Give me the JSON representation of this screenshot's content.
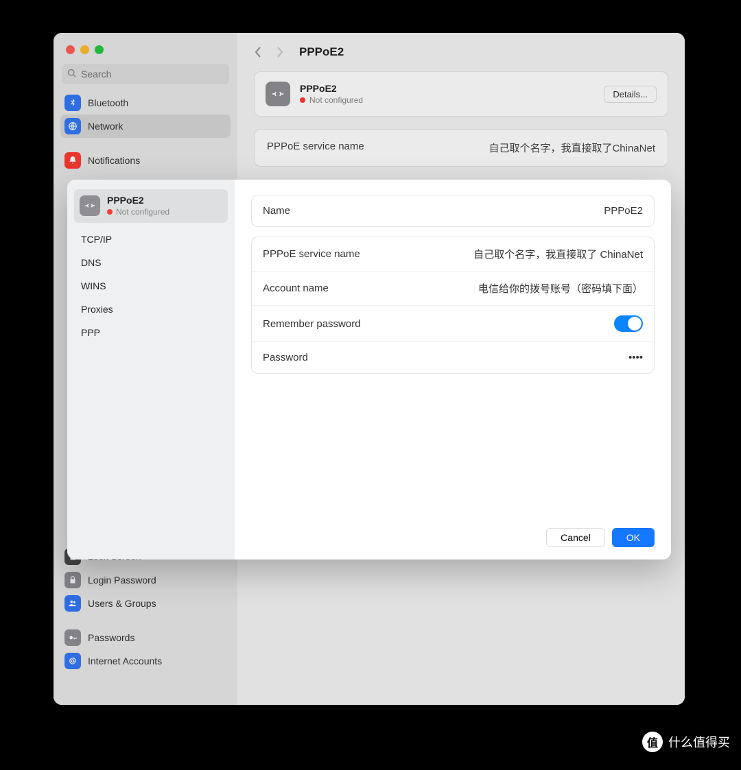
{
  "window": {
    "search_placeholder": "Search"
  },
  "sidebar": {
    "items": [
      {
        "label": "Bluetooth",
        "color": "#3478f6"
      },
      {
        "label": "Network",
        "color": "#3478f6",
        "selected": true
      },
      {
        "label": "Notifications",
        "color": "#ff3b30"
      },
      {
        "label": "Lock Screen",
        "color": "#8e8e93"
      },
      {
        "label": "Login Password",
        "color": "#8e8e93"
      },
      {
        "label": "Users & Groups",
        "color": "#3478f6"
      },
      {
        "label": "Passwords",
        "color": "#8e8e93"
      },
      {
        "label": "Internet Accounts",
        "color": "#3478f6"
      }
    ]
  },
  "header": {
    "title": "PPPoE2"
  },
  "interface": {
    "name": "PPPoE2",
    "status": "Not configured",
    "details_label": "Details...",
    "service_name_label": "PPPoE service name",
    "service_name_value": "自己取个名字，我直接取了ChinaNet"
  },
  "sheet": {
    "sidebar": {
      "top": {
        "name": "PPPoE2",
        "status": "Not configured"
      },
      "items": [
        {
          "label": "TCP/IP"
        },
        {
          "label": "DNS"
        },
        {
          "label": "WINS"
        },
        {
          "label": "Proxies"
        },
        {
          "label": "PPP"
        }
      ]
    },
    "form": {
      "name_label": "Name",
      "name_value": "PPPoE2",
      "service_name_label": "PPPoE service name",
      "service_name_value": "自己取个名字，我直接取了 ChinaNet",
      "account_name_label": "Account name",
      "account_name_value": "电信给你的拨号账号（密码填下面）",
      "remember_label": "Remember password",
      "remember_on": true,
      "password_label": "Password",
      "password_value": "••••"
    },
    "buttons": {
      "cancel": "Cancel",
      "ok": "OK"
    }
  },
  "watermark": {
    "badge": "值",
    "text": "什么值得买"
  }
}
